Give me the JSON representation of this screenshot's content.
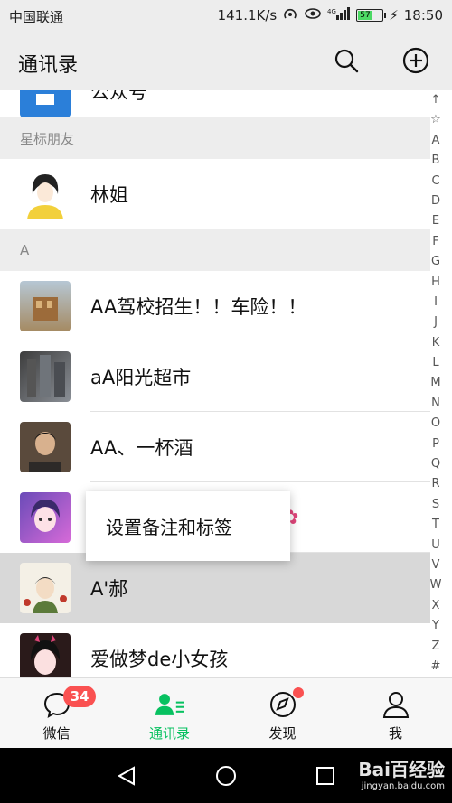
{
  "status_bar": {
    "carrier": "中国联通",
    "speed": "141.1K/s",
    "battery": "57",
    "time": "18:50"
  },
  "header": {
    "title": "通讯录",
    "search_icon": "search-icon",
    "add_icon": "plus-circle-icon"
  },
  "partial_row": {
    "name": "公众号"
  },
  "sections": {
    "starred_label": "星标朋友",
    "a_label": "A"
  },
  "contacts": {
    "starred": [
      {
        "name": "林姐"
      }
    ],
    "a": [
      {
        "name": "AA驾校招生！！车险！！"
      },
      {
        "name": "aA阳光超市"
      },
      {
        "name": "AA、一杯酒"
      },
      {
        "name": ""
      },
      {
        "name": "A'郝"
      },
      {
        "name": "爱做梦de小女孩"
      }
    ]
  },
  "popup": {
    "label": "设置备注和标签"
  },
  "index_bar": [
    "↑",
    "☆",
    "A",
    "B",
    "C",
    "D",
    "E",
    "F",
    "G",
    "H",
    "I",
    "J",
    "K",
    "L",
    "M",
    "N",
    "O",
    "P",
    "Q",
    "R",
    "S",
    "T",
    "U",
    "V",
    "W",
    "X",
    "Y",
    "Z",
    "#"
  ],
  "tabs": {
    "chats": {
      "label": "微信",
      "badge": "34"
    },
    "contacts": {
      "label": "通讯录"
    },
    "discover": {
      "label": "发现"
    },
    "me": {
      "label": "我"
    }
  },
  "watermark": {
    "brand": "Bai百经验",
    "url": "jingyan.baidu.com"
  },
  "colors": {
    "accent": "#07c160",
    "badge": "#fa5151",
    "header_bg": "#ededed"
  }
}
